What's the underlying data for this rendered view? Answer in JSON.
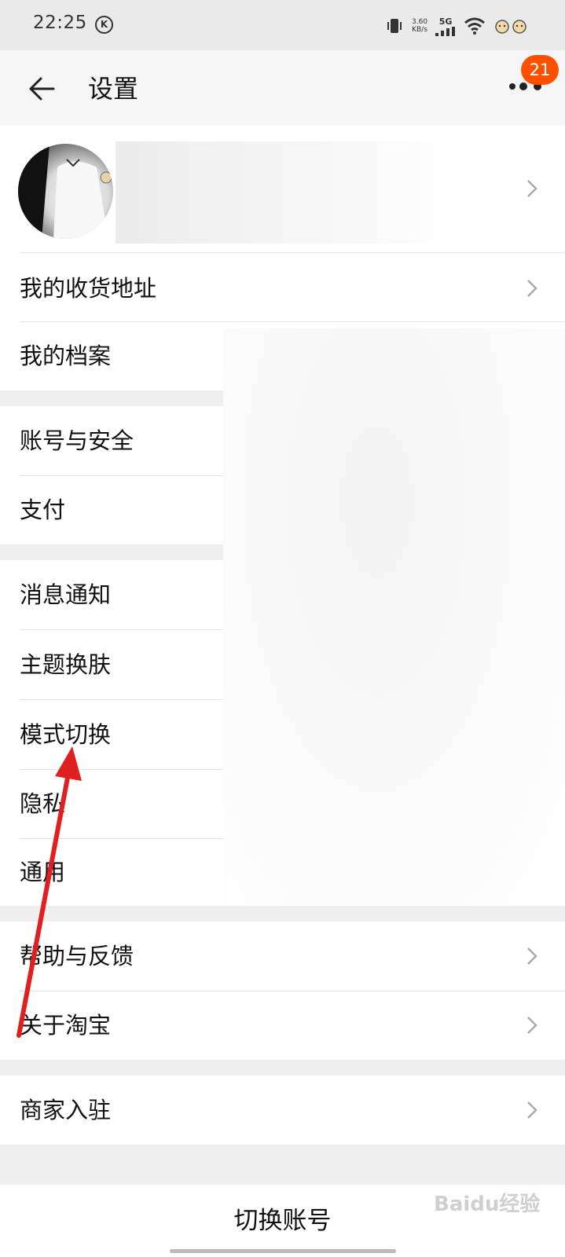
{
  "status_bar": {
    "time": "22:25",
    "k_indicator": "K",
    "speed_value": "3.60",
    "speed_unit": "KB/s",
    "network": "5G"
  },
  "header": {
    "title": "设置",
    "badge": "21",
    "icons": {
      "back": "back-arrow-icon",
      "more": "more-dots-icon"
    }
  },
  "menu": {
    "address": "我的收货地址",
    "profile": "我的档案",
    "account_security": "账号与安全",
    "payment": "支付",
    "notifications": "消息通知",
    "theme": "主题换肤",
    "mode_switch": "模式切换",
    "privacy": "隐私",
    "general": "通用",
    "help_feedback": "帮助与反馈",
    "about": "关于淘宝",
    "merchant": "商家入驻"
  },
  "switch_account": "切换账号",
  "watermark": "Baidu经验",
  "colors": {
    "accent": "#ff5000",
    "annotation_arrow": "#e02020",
    "section_gap": "#efefef"
  }
}
